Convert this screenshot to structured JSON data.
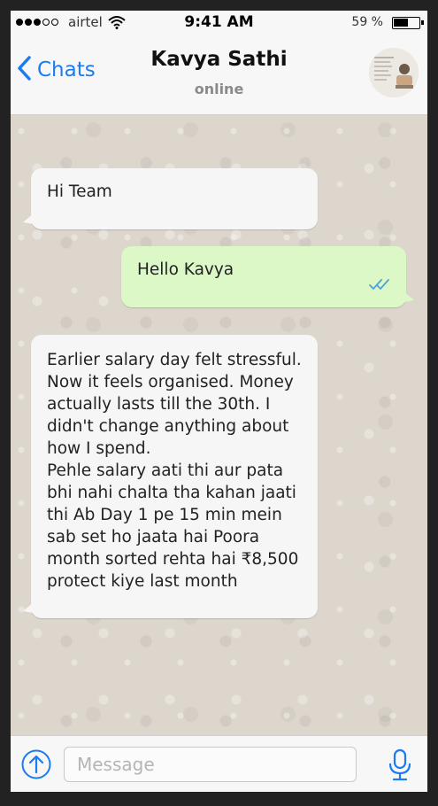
{
  "status_bar": {
    "carrier": "airtel",
    "time": "9:41 AM",
    "battery": "59 %",
    "battery_level": 0.59,
    "signal_bars_filled": 3,
    "signal_bars_total": 5
  },
  "header": {
    "back_label": "Chats",
    "contact_name": "Kavya Sathi",
    "contact_status": "online"
  },
  "messages": [
    {
      "direction": "incoming",
      "text": "Hi Team"
    },
    {
      "direction": "outgoing",
      "text": "Hello Kavya",
      "status": "read"
    },
    {
      "direction": "incoming",
      "text": "Earlier salary day felt stressful.\nNow it feels organised. Money\nactually lasts till the 30th. I\ndidn't change anything about\nhow I spend.\nPehle salary aati thi aur pata\nbhi nahi chalta tha kahan jaati\nthi Ab Day 1 pe 15 min mein\nsab set ho jaata hai Poora\nmonth sorted rehta hai ₹8,500\nprotect kiye last month"
    }
  ],
  "composer": {
    "placeholder": "Message"
  },
  "icons": {
    "back": "chevron-left-icon",
    "wifi": "wifi-icon",
    "battery": "battery-icon",
    "attach": "upload-arrow-icon",
    "mic": "microphone-icon",
    "ticks": "double-check-icon"
  },
  "colors": {
    "accent": "#1a7cf0",
    "outgoing_bubble": "#dcf8c6",
    "incoming_bubble": "#f6f6f6",
    "read_ticks": "#4aa3df"
  }
}
